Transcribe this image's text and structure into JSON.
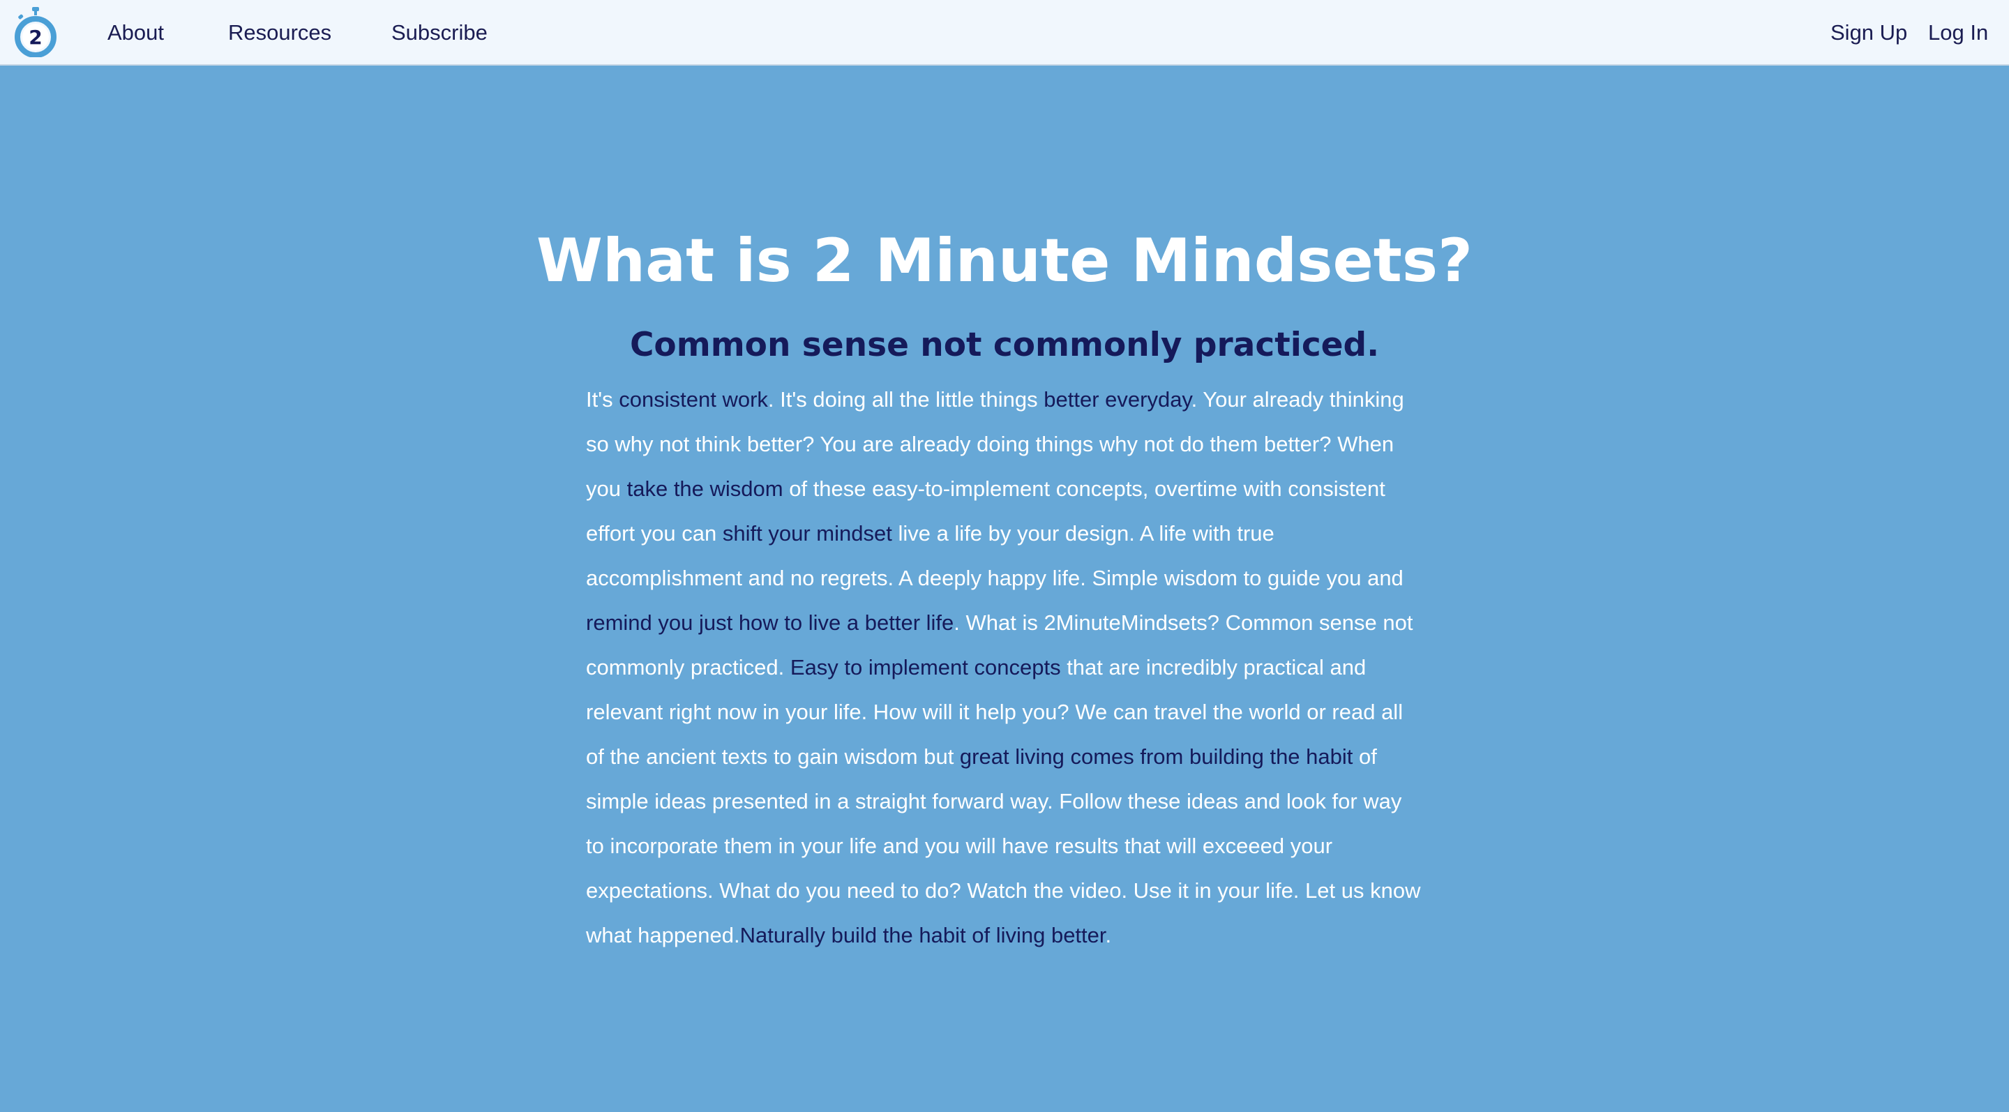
{
  "nav": {
    "logo_text": "2",
    "about": "About",
    "resources": "Resources",
    "subscribe": "Subscribe",
    "sign_up": "Sign Up",
    "log_in": "Log In"
  },
  "hero": {
    "title": "What is 2 Minute Mindsets?",
    "subtitle": "Common sense not commonly practiced."
  },
  "body": {
    "t0": "It's ",
    "l1": "consistent work",
    "t1": ". It's doing all the little things ",
    "l2": "better everyday",
    "t2": ". Your already thinking so why not think better? You are already doing things why not do them better? When you ",
    "l3": "take the wisdom",
    "t3": " of these easy-to-implement concepts, overtime with consistent effort you can ",
    "l4": "shift your mindset",
    "t4": " live a life by your design. A life with true accomplishment and no regrets. A deeply happy life. Simple wisdom to guide you and ",
    "l5": "remind you just how to live a better life",
    "t5": ". What is 2MinuteMindsets? Common sense not commonly practiced. ",
    "l6": "Easy to implement concepts",
    "t6": " that are incredibly practical and relevant right now in your life. How will it help you? We can travel the world or read all of the ancient texts to gain wisdom but ",
    "l7": "great living comes from building the habit",
    "t7": " of simple ideas presented in a straight forward way. Follow these ideas and look for way to incorporate them in your life and you will have results that will exceeed your expectations. What do you need to do? Watch the video. Use it in your life. Let us know what happened.",
    "l8": "Naturally build the habit of living better",
    "t8": "."
  },
  "colors": {
    "background": "#67a8d7",
    "navbar": "#f1f7fd",
    "highlight_text": "#151a5a",
    "body_text": "#ffffff",
    "logo_ring": "#4a9fd6"
  }
}
